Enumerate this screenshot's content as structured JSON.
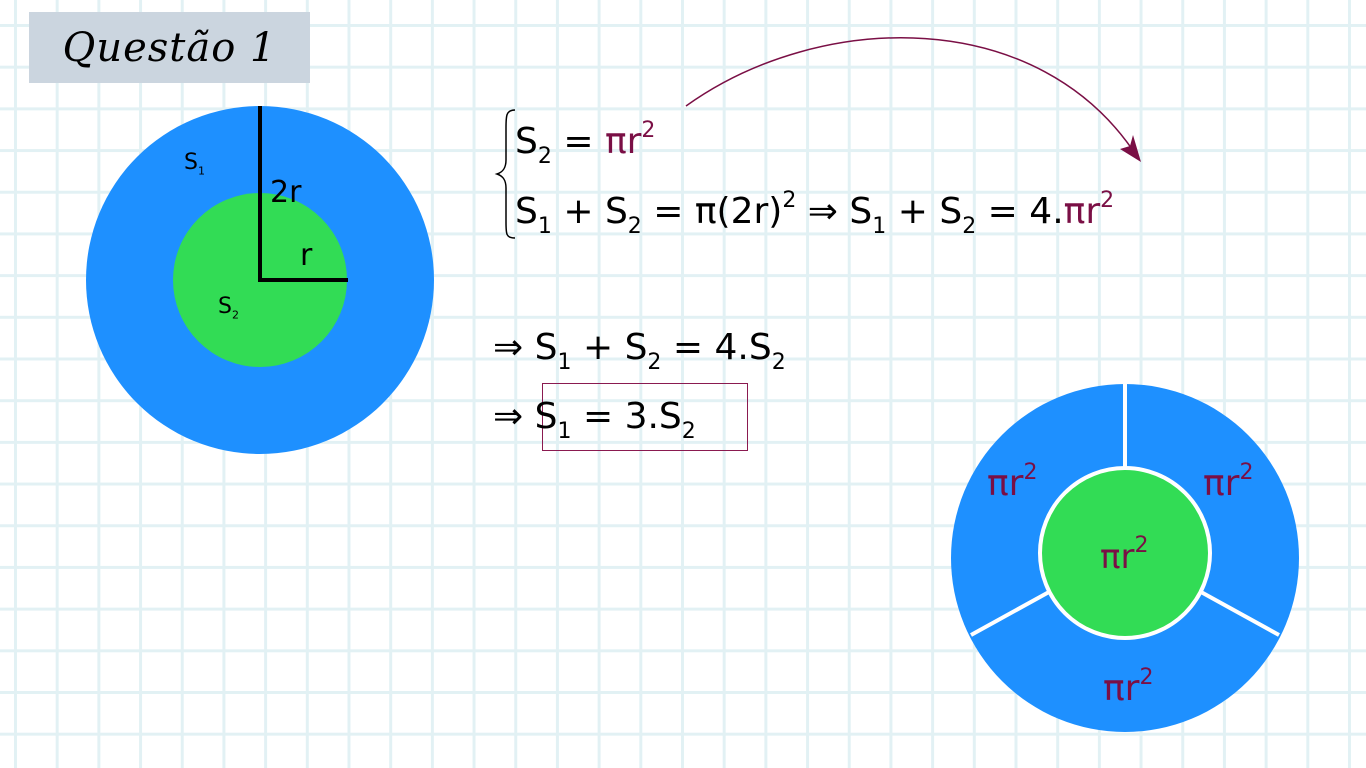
{
  "title": "Questão 1",
  "colors": {
    "outer": "#1e90ff",
    "inner": "#32dc55",
    "accent": "#7a0f45",
    "grid": "#e2f1f4",
    "title_bg": "#cbd5df"
  },
  "left_figure": {
    "s1": "S",
    "s1_sub": "1",
    "s2": "S",
    "s2_sub": "2",
    "big_radius": "2r",
    "small_radius": "r"
  },
  "system": {
    "line1": {
      "lhs": "S",
      "lhs_sub": "2",
      "eq": "=",
      "rhs": "πr",
      "rhs_sup": "2"
    },
    "line2": {
      "a": "S",
      "a_sub": "1",
      "plus": "+",
      "b": "S",
      "b_sub": "2",
      "eq": "=",
      "rhs": "π(2r)",
      "rhs_sup": "2",
      "implies": "⇒",
      "c": "S",
      "c_sub": "1",
      "plus2": "+",
      "d": "S",
      "d_sub": "2",
      "eq2": "=",
      "rhs2_prefix": "4.",
      "rhs2": "πr",
      "rhs2_sup": "2"
    }
  },
  "step1": {
    "implies": "⇒",
    "a": "S",
    "a_sub": "1",
    "plus": "+",
    "b": "S",
    "b_sub": "2",
    "eq": "=",
    "rhs": "4.S",
    "rhs_sub": "2"
  },
  "step2": {
    "implies": "⇒",
    "a": "S",
    "a_sub": "1",
    "eq": "=",
    "rhs": "3.S",
    "rhs_sub": "2"
  },
  "right_figure": {
    "label": "πr",
    "sup": "2"
  }
}
